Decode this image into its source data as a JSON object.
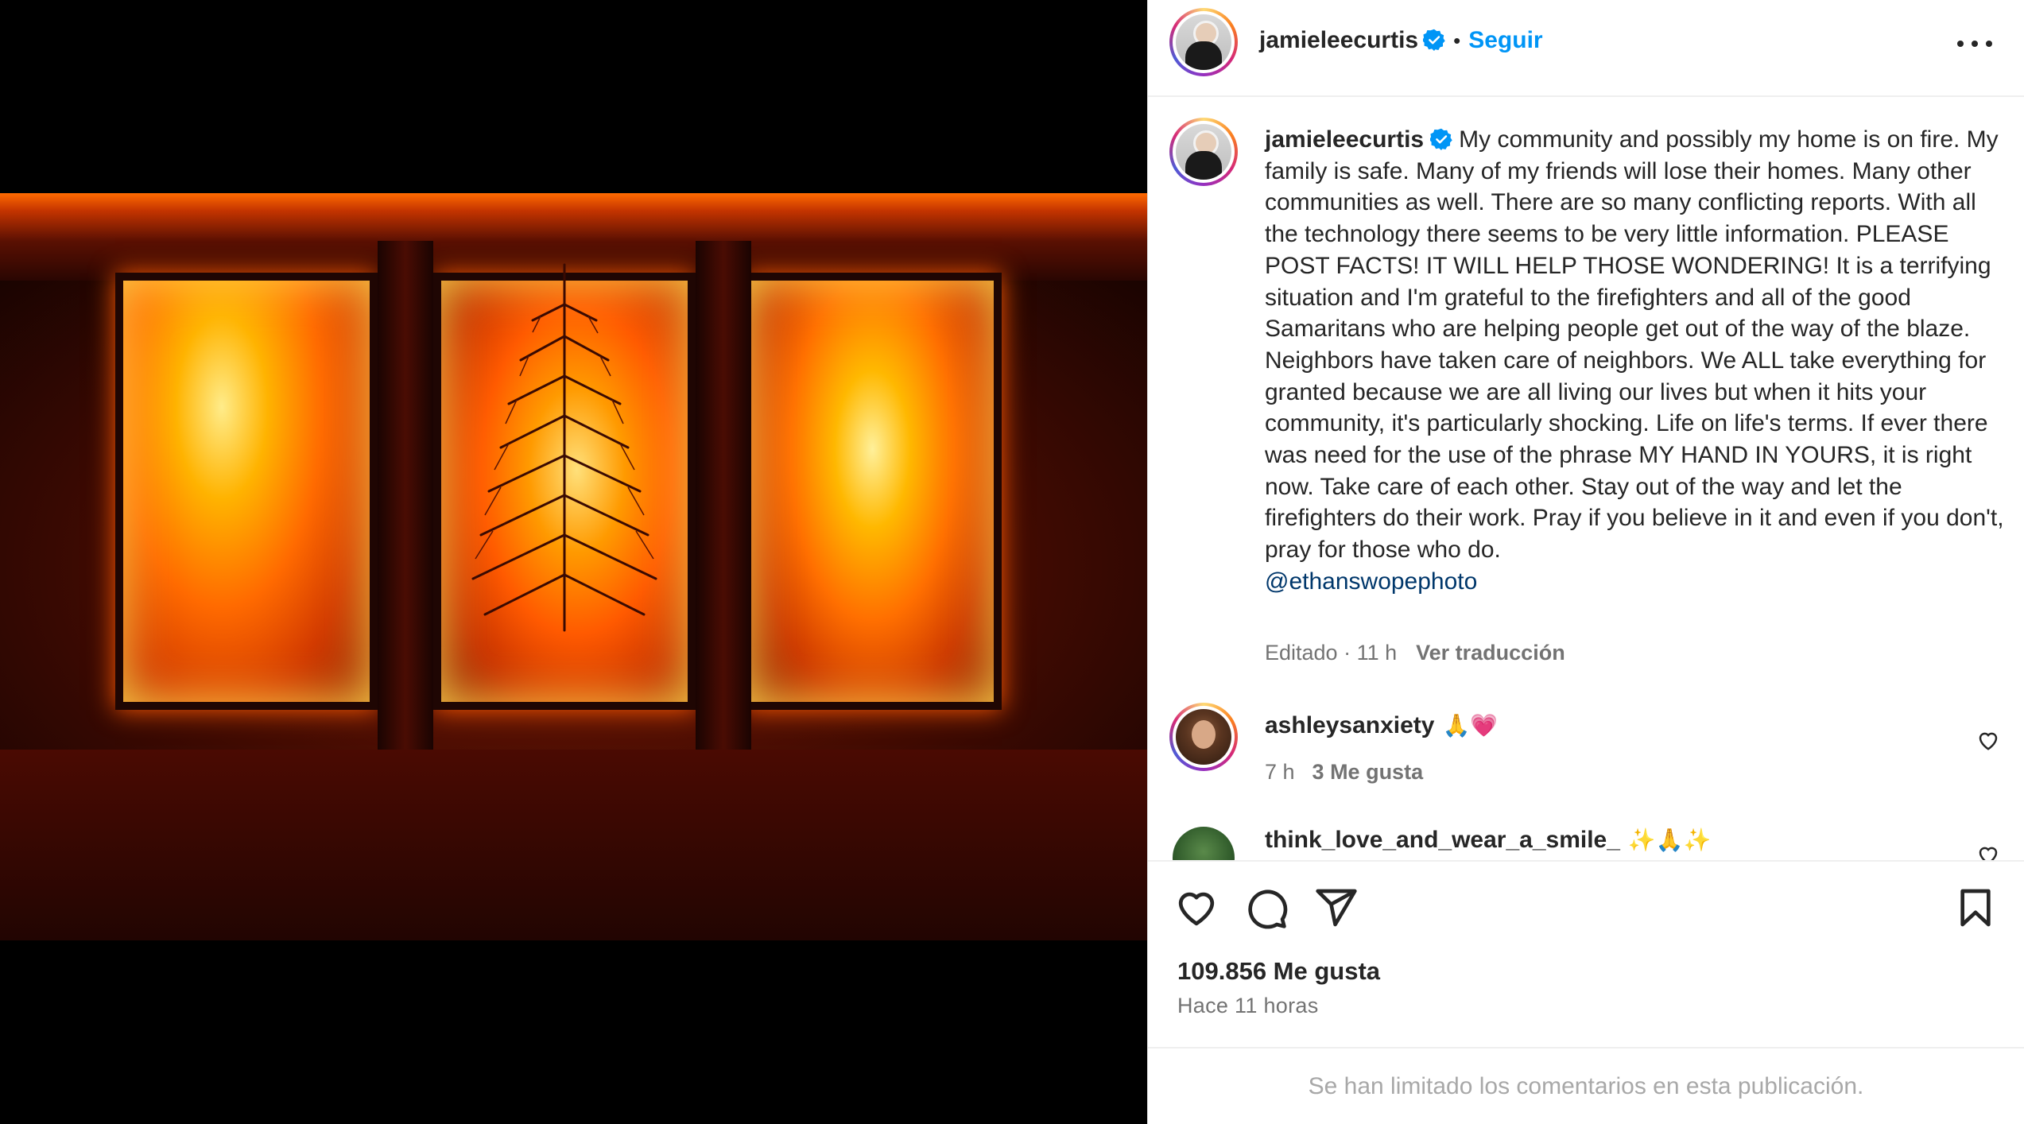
{
  "post": {
    "author": "jamieleecurtis",
    "follow_label": "Seguir",
    "separator": "•",
    "caption_text": "My community and possibly my home is on fire. My family is safe. Many of my friends will lose their homes. Many other communities as well. There are so many conflicting reports. With all the technology there seems to be very little information. PLEASE POST FACTS! IT WILL HELP THOSE WONDERING! It is a terrifying situation and I'm grateful to the firefighters and all of the good Samaritans who are helping people get out of the way of the blaze. Neighbors have taken care of neighbors. We ALL take everything for granted because we are all living our lives but when it hits your community, it's particularly shocking. Life on life's terms. If ever there was need for the use of the phrase MY HAND IN YOURS, it is right now. Take care of each other. Stay out of the way and let the firefighters do their work. Pray if you believe in it and even if you don't, pray for those who do.",
    "caption_mention": "@ethanswopephoto",
    "edited_meta": "Editado · 11 h",
    "translate_label": "Ver traducción",
    "likes_label": "109.856 Me gusta",
    "time_ago": "Hace 11 horas",
    "comments_limited": "Se han limitado los comentarios en esta publicación."
  },
  "comments": [
    {
      "username": "ashleysanxiety",
      "text": "🙏💗",
      "time": "7 h",
      "likes": "3 Me gusta"
    },
    {
      "username": "think_love_and_wear_a_smile_",
      "text": "✨🙏✨"
    }
  ],
  "icons": {
    "verified": "verified-badge-icon",
    "more": "more-options-icon",
    "like": "heart-icon",
    "comment": "comment-bubble-icon",
    "share": "paper-plane-icon",
    "save": "bookmark-icon"
  },
  "colors": {
    "accent": "#0095f6",
    "verified": "#0095f6",
    "mention": "#00376b",
    "muted": "#737373"
  }
}
